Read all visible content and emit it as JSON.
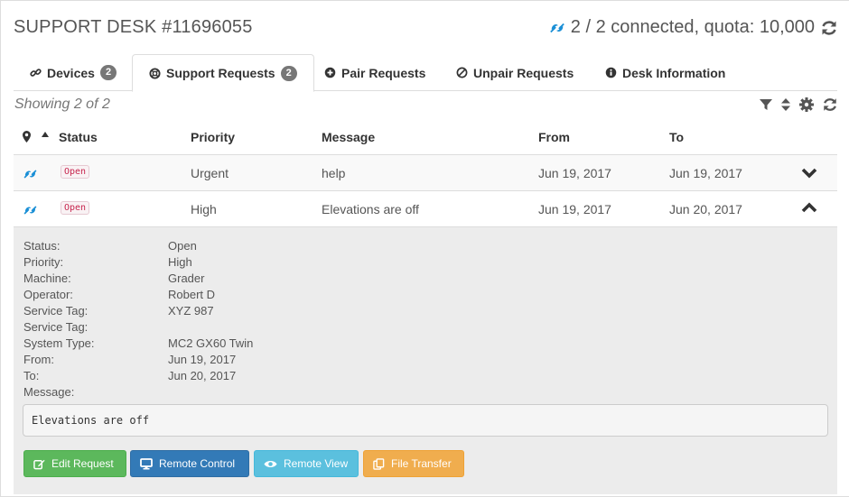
{
  "header": {
    "title": "SUPPORT DESK #11696055",
    "connection": "2 / 2 connected, quota: 10,000"
  },
  "tabs": [
    {
      "label": "Devices",
      "badge": "2",
      "icon": "link-icon"
    },
    {
      "label": "Support Requests",
      "badge": "2",
      "icon": "lifebuoy-icon",
      "active": true
    },
    {
      "label": "Pair Requests",
      "icon": "plus-circle-icon"
    },
    {
      "label": "Unpair Requests",
      "icon": "ban-icon"
    },
    {
      "label": "Desk Information",
      "icon": "info-circle-icon"
    }
  ],
  "toolbar": {
    "showing": "Showing 2 of 2"
  },
  "table": {
    "headers": [
      "Status",
      "Priority",
      "Message",
      "From",
      "To"
    ],
    "rows": [
      {
        "status": "Open",
        "priority": "Urgent",
        "message": "help",
        "from": "Jun 19, 2017",
        "to": "Jun 19, 2017",
        "expanded": false
      },
      {
        "status": "Open",
        "priority": "High",
        "message": "Elevations are off",
        "from": "Jun 19, 2017",
        "to": "Jun 20, 2017",
        "expanded": true
      }
    ]
  },
  "detail": {
    "fields": [
      {
        "label": "Status:",
        "value": "Open"
      },
      {
        "label": "Priority:",
        "value": "High"
      },
      {
        "label": "Machine:",
        "value": "Grader"
      },
      {
        "label": "Operator:",
        "value": "Robert D"
      },
      {
        "label": "Service Tag:",
        "value": "XYZ 987"
      },
      {
        "label": "Service Tag:",
        "value": ""
      },
      {
        "label": "System Type:",
        "value": "MC2 GX60 Twin"
      },
      {
        "label": "From:",
        "value": "Jun 19, 2017"
      },
      {
        "label": "To:",
        "value": "Jun 20, 2017"
      },
      {
        "label": "Message:",
        "value": ""
      }
    ],
    "message_text": "Elevations are off",
    "buttons": {
      "edit": "Edit Request",
      "remote_control": "Remote Control",
      "remote_view": "Remote View",
      "file_transfer": "File Transfer"
    }
  },
  "colors": {
    "success": "#5cb85c",
    "primary": "#337ab7",
    "info": "#5bc0de",
    "warning": "#f0ad4e",
    "status_open": "#c7254e",
    "device_icon": "#1a8fd6"
  }
}
